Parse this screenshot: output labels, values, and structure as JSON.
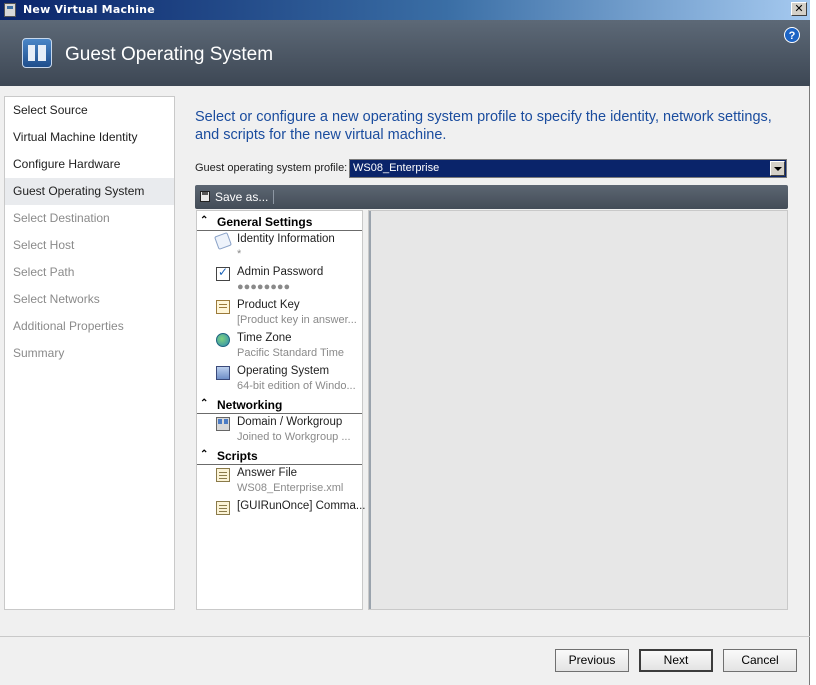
{
  "window": {
    "title": "New Virtual Machine",
    "close_glyph": "✕"
  },
  "header": {
    "title": "Guest Operating System",
    "help_glyph": "?"
  },
  "nav": {
    "items": [
      {
        "label": "Select Source",
        "state": "normal"
      },
      {
        "label": "Virtual Machine Identity",
        "state": "normal"
      },
      {
        "label": "Configure Hardware",
        "state": "normal"
      },
      {
        "label": "Guest Operating System",
        "state": "selected"
      },
      {
        "label": "Select Destination",
        "state": "disabled"
      },
      {
        "label": "Select Host",
        "state": "disabled"
      },
      {
        "label": "Select Path",
        "state": "disabled"
      },
      {
        "label": "Select Networks",
        "state": "disabled"
      },
      {
        "label": "Additional Properties",
        "state": "disabled"
      },
      {
        "label": "Summary",
        "state": "disabled"
      }
    ]
  },
  "main": {
    "intro": "Select or configure a new operating system profile to specify the identity, network settings, and scripts for the new virtual machine.",
    "profile_label": "Guest operating system profile:",
    "profile_value": "WS08_Enterprise",
    "toolbar": {
      "save_label": "Save as..."
    },
    "groups": [
      {
        "label": "General Settings",
        "items": [
          {
            "title": "Identity Information",
            "subtitle": "*",
            "icon": "identity-icon"
          },
          {
            "title": "Admin Password",
            "subtitle": "●●●●●●●●",
            "icon": "admin-password-icon"
          },
          {
            "title": "Product Key",
            "subtitle": "[Product key in answer...",
            "icon": "product-key-icon"
          },
          {
            "title": "Time Zone",
            "subtitle": "Pacific Standard Time",
            "icon": "time-zone-icon"
          },
          {
            "title": "Operating System",
            "subtitle": "64-bit edition of Windo...",
            "icon": "operating-system-icon"
          }
        ]
      },
      {
        "label": "Networking",
        "items": [
          {
            "title": "Domain / Workgroup",
            "subtitle": "Joined to Workgroup ...",
            "icon": "domain-workgroup-icon"
          }
        ]
      },
      {
        "label": "Scripts",
        "items": [
          {
            "title": "Answer File",
            "subtitle": "WS08_Enterprise.xml",
            "icon": "answer-file-icon"
          },
          {
            "title": "[GUIRunOnce] Comma...",
            "subtitle": "",
            "icon": "script-icon"
          }
        ]
      }
    ]
  },
  "footer": {
    "previous_label": "Previous",
    "next_label": "Next",
    "cancel_label": "Cancel"
  },
  "colors": {
    "intro_text": "#1a4c9e",
    "banner": "#4b5563",
    "selection": "#0a246a"
  }
}
